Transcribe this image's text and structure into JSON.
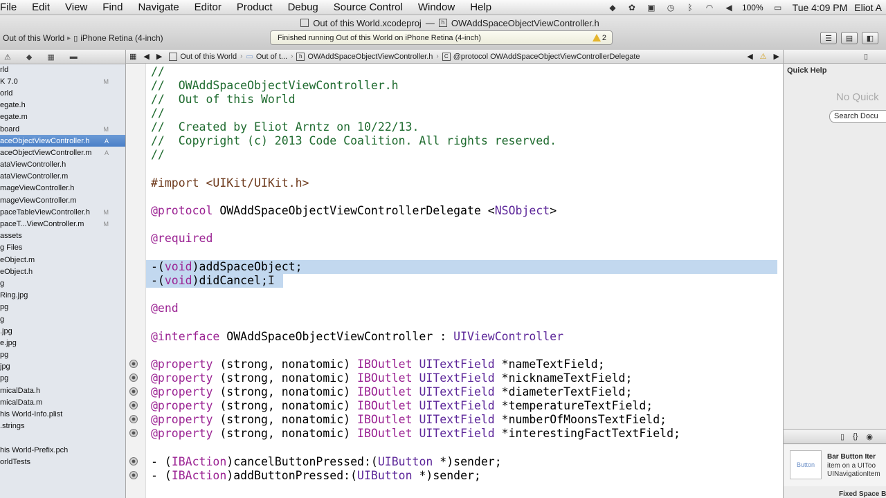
{
  "menubar": {
    "items": [
      "File",
      "Edit",
      "View",
      "Find",
      "Navigate",
      "Editor",
      "Product",
      "Debug",
      "Source Control",
      "Window",
      "Help"
    ],
    "battery": "100%",
    "clock": "Tue 4:09 PM",
    "user": "Eliot A"
  },
  "window": {
    "project_file": "Out of this World.xcodeproj",
    "dash": "—",
    "header_file": "OWAddSpaceObjectViewController.h"
  },
  "scheme": {
    "target": "Out of this World",
    "device": "iPhone Retina (4-inch)"
  },
  "activity": {
    "status": "Finished running Out of this World on iPhone Retina (4-inch)",
    "warning_count": "2"
  },
  "navigator": {
    "rows": [
      {
        "label": "rld",
        "status": ""
      },
      {
        "label": "K 7.0",
        "status": "M"
      },
      {
        "label": "orld",
        "status": ""
      },
      {
        "label": "egate.h",
        "status": ""
      },
      {
        "label": "egate.m",
        "status": ""
      },
      {
        "label": "board",
        "status": "M"
      },
      {
        "label": "aceObjectViewController.h",
        "status": "A"
      },
      {
        "label": "aceObjectViewController.m",
        "status": "A"
      },
      {
        "label": "ataViewController.h",
        "status": ""
      },
      {
        "label": "ataViewController.m",
        "status": ""
      },
      {
        "label": "mageViewController.h",
        "status": ""
      },
      {
        "label": "mageViewController.m",
        "status": ""
      },
      {
        "label": "paceTableViewController.h",
        "status": "M"
      },
      {
        "label": "paceT...ViewController.m",
        "status": "M"
      },
      {
        "label": "assets",
        "status": ""
      },
      {
        "label": "g Files",
        "status": ""
      },
      {
        "label": "eObject.m",
        "status": ""
      },
      {
        "label": "eObject.h",
        "status": ""
      },
      {
        "label": "g",
        "status": ""
      },
      {
        "label": "Ring.jpg",
        "status": ""
      },
      {
        "label": "pg",
        "status": ""
      },
      {
        "label": "g",
        "status": ""
      },
      {
        "label": ".jpg",
        "status": ""
      },
      {
        "label": "e.jpg",
        "status": ""
      },
      {
        "label": "pg",
        "status": ""
      },
      {
        "label": "jpg",
        "status": ""
      },
      {
        "label": "pg",
        "status": ""
      },
      {
        "label": "micalData.h",
        "status": ""
      },
      {
        "label": "micalData.m",
        "status": ""
      },
      {
        "label": "his World-Info.plist",
        "status": ""
      },
      {
        "label": ".strings",
        "status": ""
      },
      {
        "label": "",
        "status": ""
      },
      {
        "label": "his World-Prefix.pch",
        "status": ""
      },
      {
        "label": "orldTests",
        "status": ""
      }
    ],
    "selected_index": 6
  },
  "jumpbar": {
    "project": "Out of this World",
    "group": "Out of t...",
    "file": "OWAddSpaceObjectViewController.h",
    "symbol": "@protocol OWAddSpaceObjectViewControllerDelegate"
  },
  "code": {
    "c1": "//",
    "c2": "//  OWAddSpaceObjectViewController.h",
    "c3": "//  Out of this World",
    "c4": "//",
    "c5": "//  Created by Eliot Arntz on 10/22/13.",
    "c6": "//  Copyright (c) 2013 Code Coalition. All rights reserved.",
    "c7": "//",
    "import_kw": "#import",
    "import_path": " <UIKit/UIKit.h>",
    "protocol_kw": "@protocol",
    "protocol_name": " OWAddSpaceObjectViewControllerDelegate <",
    "protocol_base": "NSObject",
    "protocol_end": ">",
    "required_kw": "@required",
    "m1_a": "-(",
    "m1_void": "void",
    "m1_b": ")addSpaceObject;",
    "m2_a": "-(",
    "m2_void": "void",
    "m2_b": ")didCancel;",
    "end_kw": "@end",
    "interface_kw": "@interface",
    "interface_name": " OWAddSpaceObjectViewController : ",
    "interface_super": "UIViewController",
    "prop_kw": "@property",
    "prop_attrs": " (strong, nonatomic) ",
    "outlet_kw": "IBOutlet",
    "textfield_type": " UITextField",
    "properties": [
      "*nameTextField;",
      "*nicknameTextField;",
      "*diameterTextField;",
      "*temperatureTextField;",
      "*numberOfMoonsTextField;",
      "*interestingFactTextField;"
    ],
    "action_prefix": "- (",
    "action_kw": "IBAction",
    "a1_mid": ")cancelButtonPressed:(",
    "button_type": "UIButton",
    "action_suffix": " *)sender;",
    "a2_mid": ")addButtonPressed:("
  },
  "quick_help": {
    "title": "Quick Help",
    "empty": "No Quick",
    "search_button": "Search Docu"
  },
  "library": {
    "thumb_label": "Button",
    "item_name": "Bar Button Iter",
    "desc1": "item on a UIToo",
    "desc2": "UINavigationItem",
    "next_item": "Fixed Space Ba"
  }
}
